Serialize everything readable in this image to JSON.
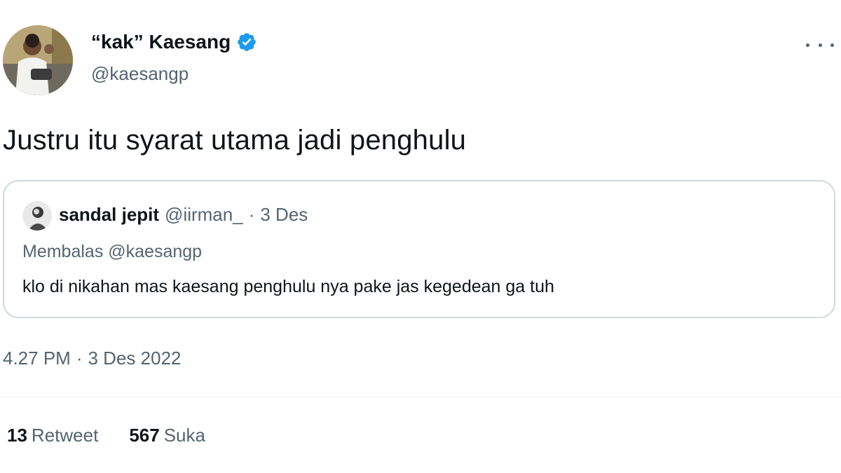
{
  "author": {
    "display_name": "“kak” Kaesang",
    "handle": "@kaesangp",
    "verified": true,
    "verified_icon": "verified-badge-icon"
  },
  "tweet": {
    "text": "Justru itu syarat utama jadi penghulu",
    "time": "4.27 PM",
    "separator": "·",
    "date": "3 Des 2022"
  },
  "quoted": {
    "display_name": "sandal jepit",
    "handle": "@iirman_",
    "separator": "·",
    "date": "3 Des",
    "reply_to": "Membalas @kaesangp",
    "text": "klo di nikahan mas kaesang penghulu nya pake jas kegedean ga tuh"
  },
  "stats": {
    "retweets_count": "13",
    "retweets_label": "Retweet",
    "likes_count": "567",
    "likes_label": "Suka"
  },
  "colors": {
    "text_primary": "#0f1419",
    "text_secondary": "#536471",
    "verified_blue": "#1d9bf0",
    "border": "#cfd9de"
  }
}
